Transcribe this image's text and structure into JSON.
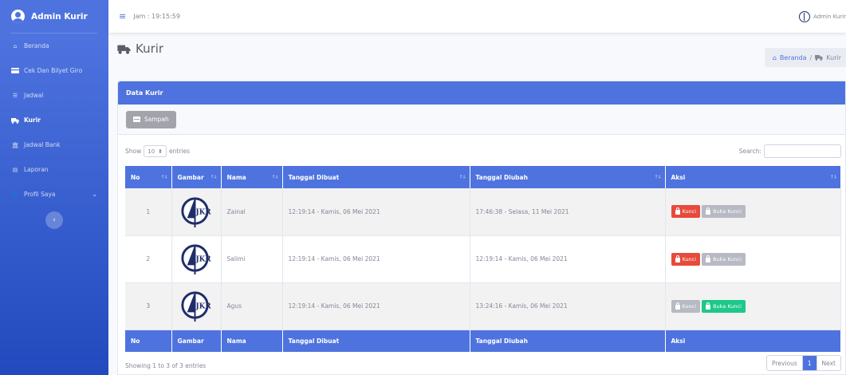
{
  "sidebar": {
    "brand": "Admin Kurir",
    "items": [
      {
        "label": "Beranda",
        "icon": "home-icon"
      },
      {
        "label": "Cek Dan Bilyet Giro",
        "icon": "card-icon"
      },
      {
        "label": "Jadwal",
        "icon": "list-icon"
      },
      {
        "label": "Kurir",
        "icon": "truck-icon"
      },
      {
        "label": "Jadwal Bank",
        "icon": "bank-icon"
      },
      {
        "label": "Laporan",
        "icon": "file-icon"
      },
      {
        "label": "Profil Saya",
        "icon": "user-icon"
      }
    ],
    "toggle": "‹"
  },
  "topbar": {
    "clock": "Jam : 19:15:59",
    "user_name": "Admin Kurir"
  },
  "page": {
    "title": "Kurir",
    "breadcrumb": {
      "home": "Beranda",
      "sep": "/",
      "current": "Kurir"
    }
  },
  "card": {
    "title": "Data Kurir",
    "trash_label": "Sampah",
    "show_label": "Show",
    "page_length": "10",
    "entries_label": "entries",
    "search_label": "Search:",
    "columns": [
      "No",
      "Gambar",
      "Nama",
      "Tanggal Dibuat",
      "Tanggal Diubah",
      "Aksi"
    ],
    "rows": [
      {
        "no": "1",
        "nama": "Zainal",
        "dibuat": "12:19:14 - Kamis, 06 Mei 2021",
        "diubah": "17:46:38 - Selasa, 11 Mei 2021",
        "lock_label": "Kunci",
        "unlock_label": "Buka Kunci",
        "locked": false
      },
      {
        "no": "2",
        "nama": "Salimi",
        "dibuat": "12:19:14 - Kamis, 06 Mei 2021",
        "diubah": "12:19:14 - Kamis, 06 Mei 2021",
        "lock_label": "Kunci",
        "unlock_label": "Buka Kunci",
        "locked": false
      },
      {
        "no": "3",
        "nama": "Agus",
        "dibuat": "12:19:14 - Kamis, 06 Mei 2021",
        "diubah": "13:24:16 - Kamis, 06 Mei 2021",
        "lock_label": "Kunci",
        "unlock_label": "Buka Kunci",
        "locked": true
      }
    ],
    "info": "Showing 1 to 3 of 3 entries",
    "pager": {
      "prev": "Previous",
      "page": "1",
      "next": "Next"
    }
  },
  "colors": {
    "primary": "#4e73df",
    "danger": "#e74a3b",
    "success": "#1cc88a",
    "secondary": "#b7b9c3"
  }
}
